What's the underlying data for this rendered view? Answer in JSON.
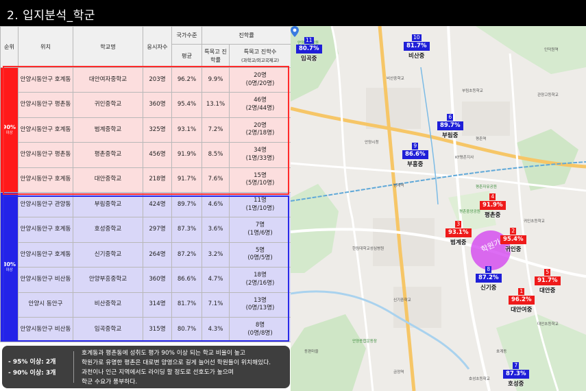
{
  "page_title": "2. 입지분석_학군",
  "table": {
    "headers": {
      "rank": "순위",
      "location": "위치",
      "school": "학교명",
      "applicants": "응시자수",
      "national_group": "국가수준",
      "national_avg": "평균",
      "advancement_group": "진학률",
      "special_rate": "특목고 진학률",
      "special_count": "특목고 진학수",
      "special_count_sub": "(과학고/외고국제고)"
    },
    "groups": [
      {
        "rank_label": "90%",
        "rank_sub": "이상",
        "color": "#ff1a1a",
        "rows": [
          {
            "location": "안양시동안구 호계동",
            "school": "대안여자중학교",
            "applicants": "203명",
            "avg": "96.2%",
            "rate": "9.9%",
            "count": "20명",
            "count_detail": "(0명/20명)"
          },
          {
            "location": "안양시동안구 평촌동",
            "school": "귀인중학교",
            "applicants": "360명",
            "avg": "95.4%",
            "rate": "13.1%",
            "count": "46명",
            "count_detail": "(2명/44명)"
          },
          {
            "location": "안양시동안구 호계동",
            "school": "범계중학교",
            "applicants": "325명",
            "avg": "93.1%",
            "rate": "7.2%",
            "count": "20명",
            "count_detail": "(2명/18명)"
          },
          {
            "location": "안양시동안구 평촌동",
            "school": "평촌중학교",
            "applicants": "456명",
            "avg": "91.9%",
            "rate": "8.5%",
            "count": "34명",
            "count_detail": "(1명/33명)"
          },
          {
            "location": "안양시동안구 호계동",
            "school": "대안중학교",
            "applicants": "218명",
            "avg": "91.7%",
            "rate": "7.6%",
            "count": "15명",
            "count_detail": "(5명/10명)"
          }
        ]
      },
      {
        "rank_label": "80%",
        "rank_sub": "이상",
        "color": "#2323e8",
        "rows": [
          {
            "location": "안양시동안구 관양동",
            "school": "부림중학교",
            "applicants": "424명",
            "avg": "89.7%",
            "rate": "4.6%",
            "count": "11명",
            "count_detail": "(1명/10명)"
          },
          {
            "location": "안양시동안구 호계동",
            "school": "호성중학교",
            "applicants": "297명",
            "avg": "87.3%",
            "rate": "3.6%",
            "count": "7명",
            "count_detail": "(1명/6명)"
          },
          {
            "location": "안양시동안구 호계동",
            "school": "신기중학교",
            "applicants": "264명",
            "avg": "87.2%",
            "rate": "3.2%",
            "count": "5명",
            "count_detail": "(0명/5명)"
          },
          {
            "location": "안양시동안구 비산동",
            "school": "안양부흥중학교",
            "applicants": "360명",
            "avg": "86.6%",
            "rate": "4.7%",
            "count": "18명",
            "count_detail": "(2명/16명)"
          },
          {
            "location": "안양시 동안구",
            "school": "비산중학교",
            "applicants": "314명",
            "avg": "81.7%",
            "rate": "7.1%",
            "count": "13명",
            "count_detail": "(0명/13명)"
          },
          {
            "location": "안양시동안구 비산동",
            "school": "임곡중학교",
            "applicants": "315명",
            "avg": "80.7%",
            "rate": "4.3%",
            "count": "8명",
            "count_detail": "(0명/8명)"
          }
        ]
      }
    ]
  },
  "summary": {
    "line1": "- 95% 이상: 2개",
    "line2": "- 90% 이상: 3개",
    "text1": "호계동과 평촌동에 성취도 평가 90% 이상 되는 학교 비율이 높고",
    "text2": "학원가로 유명한 평촌은 대로변 양영으로 길게 늘어선 학원들이 위치해있다.",
    "text3": "과천이나 인근 지역에서도 라이딩 할 정도로 선호도가 높으며",
    "text4": "학군 수요가 풍부하다."
  },
  "map": {
    "academy_label": "학원가",
    "markers": [
      {
        "num": "11",
        "pct": "80.7%",
        "name": "임곡중",
        "type": "blue"
      },
      {
        "num": "10",
        "pct": "81.7%",
        "name": "비산중",
        "type": "blue"
      },
      {
        "num": "6",
        "pct": "89.7%",
        "name": "부림중",
        "type": "blue"
      },
      {
        "num": "9",
        "pct": "86.6%",
        "name": "부흥중",
        "type": "blue"
      },
      {
        "num": "4",
        "pct": "91.9%",
        "name": "평촌중",
        "type": "red"
      },
      {
        "num": "3",
        "pct": "93.1%",
        "name": "범계중",
        "type": "red"
      },
      {
        "num": "2",
        "pct": "95.4%",
        "name": "귀인중",
        "type": "red"
      },
      {
        "num": "8",
        "pct": "87.2%",
        "name": "신기중",
        "type": "blue"
      },
      {
        "num": "5",
        "pct": "91.7%",
        "name": "대안중",
        "type": "red"
      },
      {
        "num": "1",
        "pct": "96.2%",
        "name": "대안여중",
        "type": "red"
      },
      {
        "num": "7",
        "pct": "87.3%",
        "name": "호성중",
        "type": "blue"
      }
    ],
    "places": [
      "비산중학교",
      "안양예술공원",
      "평촌역",
      "범계역",
      "관양고등학교",
      "귀인초등학교",
      "안양시청",
      "평촌중앙공원",
      "호계동",
      "동편마을",
      "KT평촌지사",
      "한림대학교성심병원",
      "대안초등학교",
      "호성초등학교",
      "신기중학교",
      "안양종합운동장",
      "인덕원역",
      "부림초등학교",
      "평촌자유공원",
      "금정역"
    ]
  },
  "colors": {
    "red": "#ff1a1a",
    "blue": "#2323e8",
    "academy": "#d23cf0"
  }
}
